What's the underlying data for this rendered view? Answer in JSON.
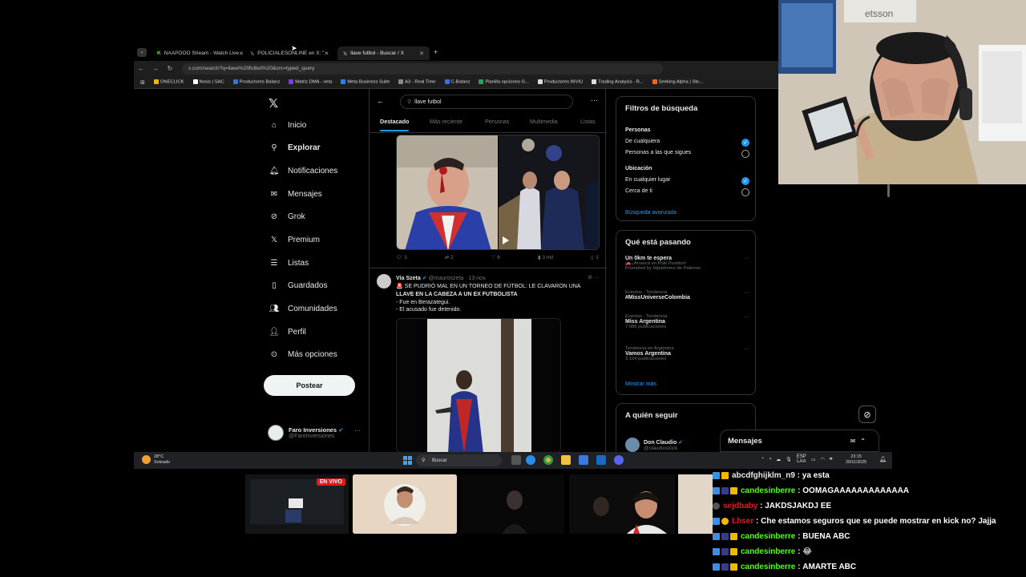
{
  "browser": {
    "tabs": [
      {
        "label": "NAAPOOO Stream - Watch Live",
        "active": false
      },
      {
        "label": "POLICIALESONLINE en X: \"",
        "active": false
      },
      {
        "label": "llave futbol - Buscar / X",
        "active": true
      }
    ],
    "url": "x.com/search?q=llave%20futbol%20&src=typed_query",
    "bookmarks": [
      "ONECLICK",
      "Nosis | SAC",
      "Productores Balanz",
      "Matriz DMA - veta",
      "Meta Business Suite",
      "A3 - Real Time",
      "C-Balanz",
      "Planilla opciones G...",
      "Productores INVIU",
      "Trading Analysis - R...",
      "Seeking Alpha | Sto..."
    ]
  },
  "x_nav": {
    "items": [
      "Inicio",
      "Explorar",
      "Notificaciones",
      "Mensajes",
      "Grok",
      "Premium",
      "Listas",
      "Guardados",
      "Comunidades",
      "Perfil",
      "Más opciones"
    ],
    "post_button": "Postear",
    "profile_name": "Faro Inversiones",
    "profile_handle": "@FaroInversiones"
  },
  "search": {
    "query": "llave futbol",
    "tabs": [
      "Destacado",
      "Más reciente",
      "Personas",
      "Multimedia",
      "Listas"
    ]
  },
  "tweet1": {
    "actions": {
      "replies": "3",
      "reposts": "2",
      "likes": "6",
      "views": "3 mil"
    }
  },
  "tweet2": {
    "author": "Vía Szeta",
    "handle": "@mauroszeta · 13 nov.",
    "lines": [
      "🚨 SE PUDRIÓ MAL EN UN TORNEO DE FÚTBOL: LE CLAVARON UNA",
      "LLAVE EN LA CABEZA A UN EX FUTBOLISTA",
      "- Fue en Berazategui.",
      "- El acusado fue detenido."
    ]
  },
  "filters": {
    "title": "Filtros de búsqueda",
    "personas_label": "Personas",
    "personas_opt1": "De cualquiera",
    "personas_opt2": "Personas a las que sigues",
    "ubicacion_label": "Ubicación",
    "ubicacion_opt1": "En cualquier lugar",
    "ubicacion_opt2": "Cerca de ti",
    "advanced": "Búsqueda avanzada"
  },
  "trending": {
    "title": "Qué está pasando",
    "items": [
      {
        "meta": "",
        "title": "Un 0km te espera",
        "sub": "🚗 ¡Arrancá en Pole Position!",
        "sub2": "Promoted by Hipódromo de Palermo"
      },
      {
        "meta": "Eventos · Tendencia",
        "title": "#MissUniverseColombia",
        "sub": "",
        "sub2": ""
      },
      {
        "meta": "Eventos · Tendencia",
        "title": "Miss Argentina",
        "sub": "7.086 publicaciones",
        "sub2": ""
      },
      {
        "meta": "Tendencia en Argentina",
        "title": "Vamos Argentina",
        "sub": "3.104 publicaciones",
        "sub2": ""
      }
    ],
    "show_more": "Mostrar más"
  },
  "who_to_follow": {
    "title": "A quién seguir",
    "name": "Don Claudio",
    "handle": "@claudiostock"
  },
  "messages_bar": "Mensajes",
  "taskbar": {
    "temp": "28°C",
    "weather": "Soleado",
    "search": "Buscar",
    "lang1": "ESP",
    "lang2": "LAA",
    "time": "23:15",
    "date": "20/11/2025"
  },
  "stream": {
    "live_badge": "EN VIVO",
    "webcam_text": "etsson"
  },
  "chat": [
    {
      "user": "abcdfghijklm_n9",
      "color": "#e7e9ea",
      "msg": "ya esta"
    },
    {
      "user": "candesinberre",
      "color": "#53fc18",
      "msg": "OOMAGAAAAAAAAAAAAA"
    },
    {
      "user": "sejdbaby",
      "color": "#e0191b",
      "msg": "JAKDSJAKDJ EE"
    },
    {
      "user": "Lhser",
      "color": "#e0191b",
      "msg": "Che estamos seguros que se puede mostrar en kick no? Jajja"
    },
    {
      "user": "candesinberre",
      "color": "#53fc18",
      "msg": "BUENA ABC"
    },
    {
      "user": "candesinberre",
      "color": "#53fc18",
      "msg": "😂"
    },
    {
      "user": "candesinberre",
      "color": "#53fc18",
      "msg": "AMARTE ABC"
    }
  ]
}
